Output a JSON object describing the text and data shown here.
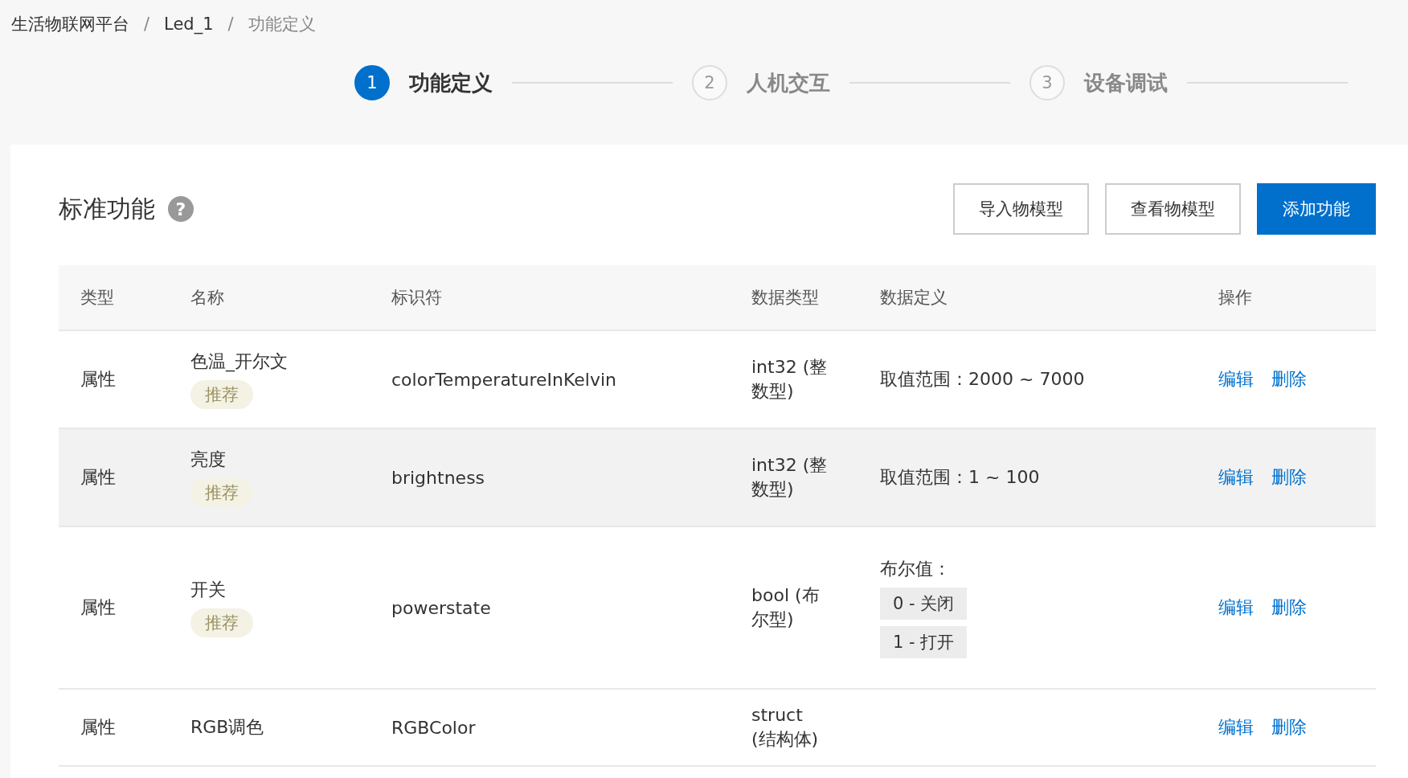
{
  "breadcrumb": [
    {
      "kind": "link",
      "text": "生活物联网平台"
    },
    {
      "kind": "separator",
      "text": "/"
    },
    {
      "kind": "link",
      "text": "Led_1"
    },
    {
      "kind": "separator",
      "text": "/"
    },
    {
      "kind": "current",
      "text": "功能定义"
    }
  ],
  "steps": [
    {
      "number": "1",
      "label": "功能定义",
      "selected": true
    },
    {
      "number": "2",
      "label": "人机交互",
      "selected": false
    },
    {
      "number": "3",
      "label": "设备调试",
      "selected": false
    }
  ],
  "section": {
    "title": "标准功能",
    "help_icon": "?"
  },
  "buttons": [
    {
      "label": "导入物模型",
      "kind": "secondary"
    },
    {
      "label": "查看物模型",
      "kind": "secondary"
    },
    {
      "label": "添加功能",
      "kind": "primary"
    }
  ],
  "table": {
    "columns": [
      "类型",
      "名称",
      "标识符",
      "数据类型",
      "数据定义",
      "操作"
    ],
    "rows": [
      {
        "type": "属性",
        "name": "色温_开尔文",
        "tag": "推荐",
        "identifier": "colorTemperatureInKelvin",
        "data_type": "int32 (整数型)",
        "definition": {
          "kind": "range",
          "text": "取值范围：2000 ~ 7000"
        },
        "actions": [
          "编辑",
          "删除"
        ],
        "shaded": false
      },
      {
        "type": "属性",
        "name": "亮度",
        "tag": "推荐",
        "identifier": "brightness",
        "data_type": "int32 (整数型)",
        "definition": {
          "kind": "range",
          "text": "取值范围：1 ~ 100"
        },
        "actions": [
          "编辑",
          "删除"
        ],
        "shaded": true
      },
      {
        "type": "属性",
        "name": "开关",
        "tag": "推荐",
        "identifier": "powerstate",
        "data_type": "bool (布尔型)",
        "definition": {
          "kind": "enum",
          "text": "布尔值：",
          "values": [
            "0 - 关闭",
            "1 - 打开"
          ]
        },
        "actions": [
          "编辑",
          "删除"
        ],
        "shaded": false
      },
      {
        "type": "属性",
        "name": "RGB调色",
        "identifier": "RGBColor",
        "data_type": "struct (结构体)",
        "actions": [
          "编辑",
          "删除"
        ],
        "shaded": false
      }
    ]
  }
}
